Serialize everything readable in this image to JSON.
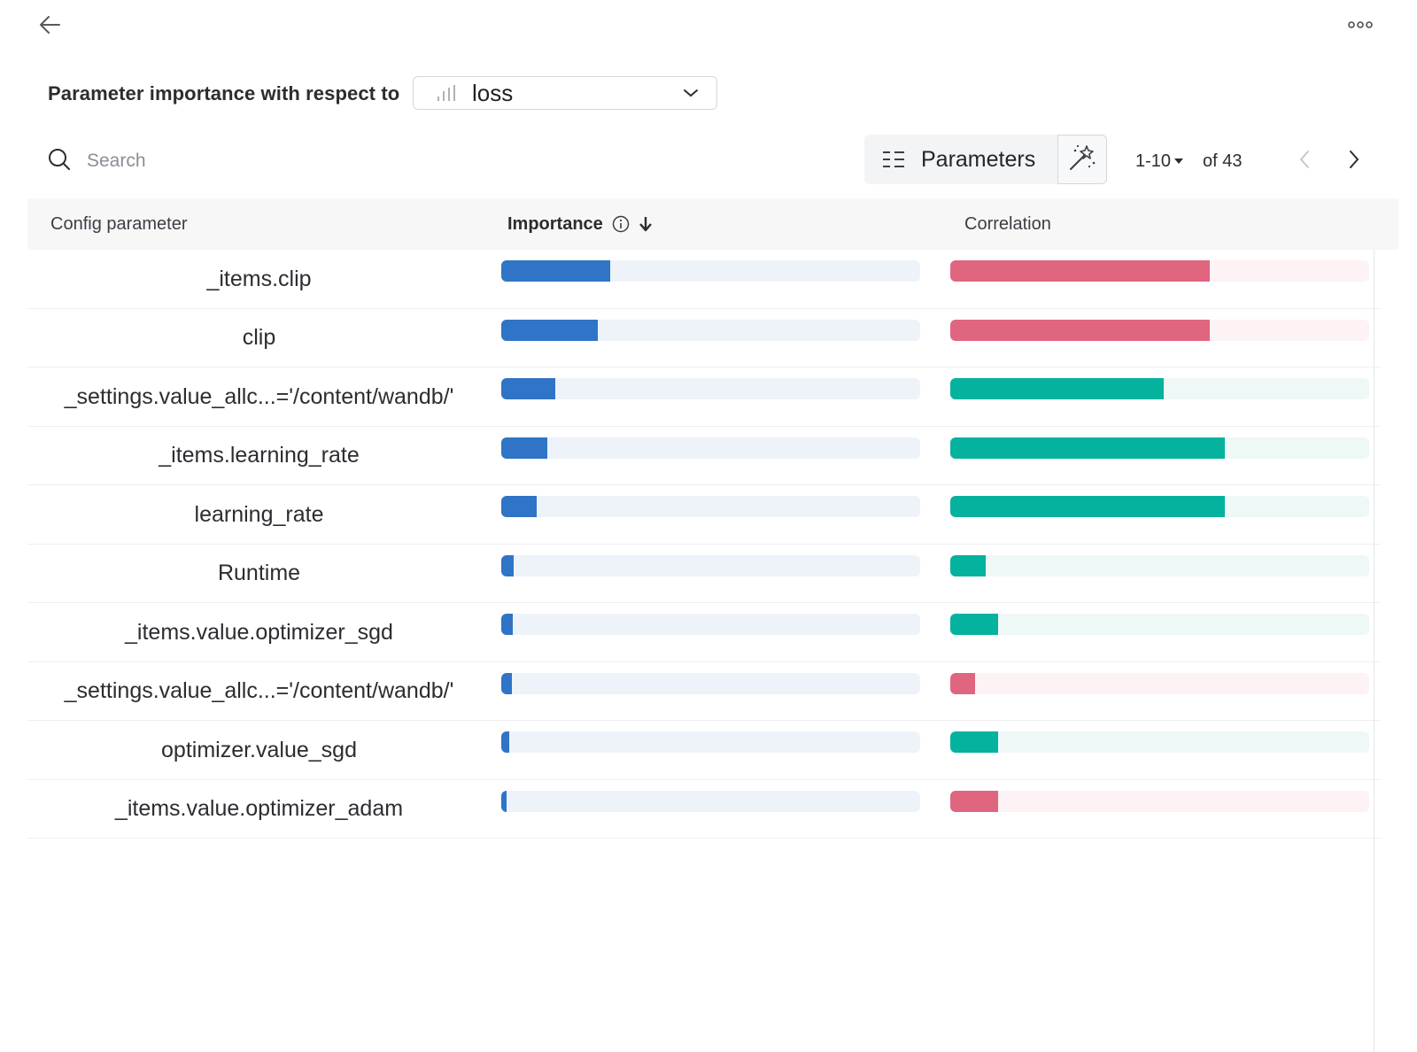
{
  "header": {
    "back_icon": "arrow-left-icon",
    "more_icon": "more-horizontal-icon"
  },
  "importance": {
    "label": "Parameter importance with respect to",
    "metric": "loss",
    "metric_icon": "bar-chart-icon"
  },
  "search": {
    "placeholder": "Search",
    "value": ""
  },
  "toolbar": {
    "parameters_label": "Parameters",
    "parameters_icon": "list-icon",
    "wand_icon": "magic-wand-icon"
  },
  "pager": {
    "range": "1-10",
    "total": "of 43"
  },
  "table": {
    "headers": {
      "config": "Config parameter",
      "importance": "Importance",
      "correlation": "Correlation"
    },
    "rows": [
      {
        "name": "_items.clip",
        "importance": 0.26,
        "correlation": 0.62,
        "correlation_sign": "neg"
      },
      {
        "name": "clip",
        "importance": 0.23,
        "correlation": 0.62,
        "correlation_sign": "neg"
      },
      {
        "name": "_settings.value_allc...='/content/wandb/'",
        "importance": 0.13,
        "correlation": 0.51,
        "correlation_sign": "pos"
      },
      {
        "name": "_items.learning_rate",
        "importance": 0.11,
        "correlation": 0.655,
        "correlation_sign": "pos"
      },
      {
        "name": "learning_rate",
        "importance": 0.085,
        "correlation": 0.655,
        "correlation_sign": "pos"
      },
      {
        "name": "Runtime",
        "importance": 0.03,
        "correlation": 0.085,
        "correlation_sign": "pos"
      },
      {
        "name": "_items.value.optimizer_sgd",
        "importance": 0.028,
        "correlation": 0.115,
        "correlation_sign": "pos"
      },
      {
        "name": "_settings.value_allc...='/content/wandb/'",
        "importance": 0.025,
        "correlation": 0.06,
        "correlation_sign": "neg"
      },
      {
        "name": "optimizer.value_sgd",
        "importance": 0.018,
        "correlation": 0.115,
        "correlation_sign": "pos"
      },
      {
        "name": "_items.value.optimizer_adam",
        "importance": 0.012,
        "correlation": 0.115,
        "correlation_sign": "neg"
      }
    ]
  },
  "colors": {
    "importance_bar": "#2f74c6",
    "correlation_negative": "#e06680",
    "correlation_positive": "#04b29e"
  }
}
